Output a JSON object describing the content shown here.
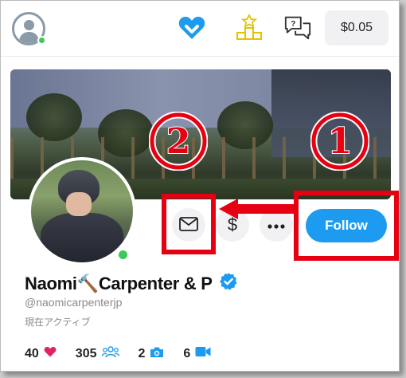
{
  "topbar": {
    "balance": "$0.05",
    "icons": [
      "user-avatar-icon",
      "heart-logo-icon",
      "leaderboard-icon",
      "chat-question-icon"
    ]
  },
  "profile": {
    "display_name": "Naomi🔨Carpenter & P",
    "handle": "@naomicarpenterjp",
    "status": "現在アクティブ",
    "verified": true
  },
  "actions": {
    "follow_label": "Follow"
  },
  "stats": {
    "likes": "40",
    "subscribers": "305",
    "photos": "2",
    "videos": "6"
  },
  "annotations": {
    "marker_1": "①",
    "marker_2": "②"
  },
  "colors": {
    "accent_blue": "#1d9bf0",
    "annotation_red": "#e60012",
    "online_green": "#3cc95a",
    "like_red": "#e0245e"
  }
}
